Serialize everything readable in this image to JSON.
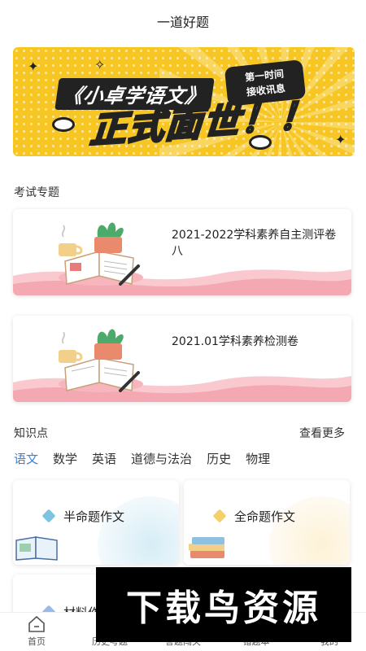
{
  "header": {
    "title": "一道好题"
  },
  "banner": {
    "title_line1": "《小卓学语文》",
    "title_line2": "正式面世！！",
    "tag_line1": "第一时间",
    "tag_line2": "接收讯息",
    "bg_color": "#f7c623"
  },
  "exam_section": {
    "title": "考试专题",
    "cards": [
      {
        "label": "2021-2022学科素养自主测评卷八",
        "icon": "book-plant-illustration"
      },
      {
        "label": "2021.01学科素养检测卷",
        "icon": "book-plant-illustration"
      }
    ]
  },
  "knowledge_section": {
    "title": "知识点",
    "more_label": "查看更多",
    "tabs": [
      {
        "label": "语文",
        "active": true
      },
      {
        "label": "数学",
        "active": false
      },
      {
        "label": "英语",
        "active": false
      },
      {
        "label": "道德与法治",
        "active": false
      },
      {
        "label": "历史",
        "active": false
      },
      {
        "label": "物理",
        "active": false
      }
    ],
    "cards": [
      {
        "label": "半命题作文",
        "cube_color": "#7cc4e0",
        "icon": "open-book-icon"
      },
      {
        "label": "全命题作文",
        "cube_color": "#f5cf6a",
        "icon": "book-stack-icon"
      },
      {
        "label": "材料作文",
        "cube_color": "#9ab8e8"
      }
    ]
  },
  "bottom_nav": {
    "items": [
      {
        "label": "首页",
        "icon": "home-icon"
      },
      {
        "label": "历史考题",
        "icon": "history-icon"
      },
      {
        "label": "答题闯关",
        "icon": "challenge-icon"
      },
      {
        "label": "错题本",
        "icon": "notebook-icon"
      },
      {
        "label": "我的",
        "icon": "user-icon"
      }
    ]
  },
  "watermark": {
    "text": "下载鸟资源"
  },
  "colors": {
    "accent": "#3b82d6",
    "banner": "#f7c623"
  }
}
